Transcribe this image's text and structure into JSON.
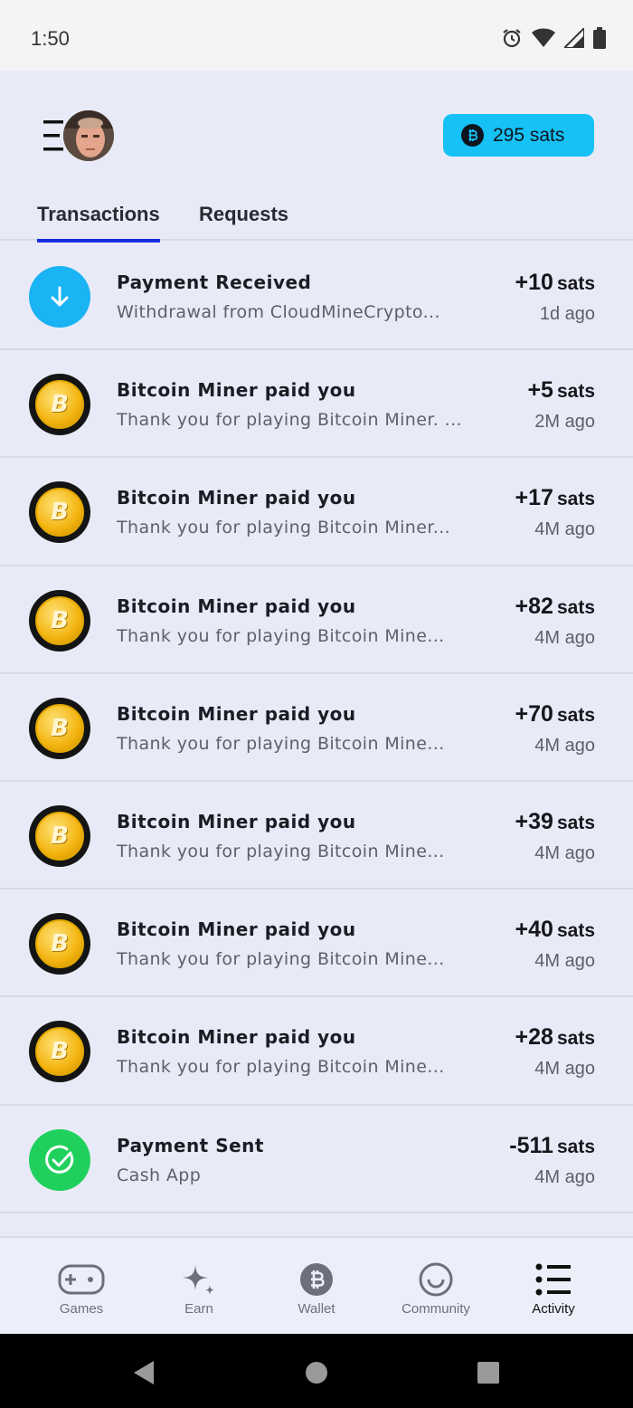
{
  "status_bar": {
    "time": "1:50"
  },
  "header": {
    "balance": "295 sats"
  },
  "tabs": [
    {
      "label": "Transactions",
      "active": true
    },
    {
      "label": "Requests",
      "active": false
    }
  ],
  "transactions": [
    {
      "type": "received",
      "title": "Payment Received",
      "subtitle": "Withdrawal from CloudMineCrypto...",
      "amount": "+10",
      "unit": "sats",
      "time": "1d ago"
    },
    {
      "type": "coin",
      "title": "Bitcoin Miner paid you",
      "subtitle": "Thank you for playing Bitcoin Miner. ...",
      "amount": "+5",
      "unit": "sats",
      "time": "2M ago"
    },
    {
      "type": "coin",
      "title": "Bitcoin Miner paid you",
      "subtitle": "Thank you for playing Bitcoin Miner...",
      "amount": "+17",
      "unit": "sats",
      "time": "4M ago"
    },
    {
      "type": "coin",
      "title": "Bitcoin Miner paid you",
      "subtitle": "Thank you for playing Bitcoin Mine...",
      "amount": "+82",
      "unit": "sats",
      "time": "4M ago"
    },
    {
      "type": "coin",
      "title": "Bitcoin Miner paid you",
      "subtitle": "Thank you for playing Bitcoin Mine...",
      "amount": "+70",
      "unit": "sats",
      "time": "4M ago"
    },
    {
      "type": "coin",
      "title": "Bitcoin Miner paid you",
      "subtitle": "Thank you for playing Bitcoin Mine...",
      "amount": "+39",
      "unit": "sats",
      "time": "4M ago"
    },
    {
      "type": "coin",
      "title": "Bitcoin Miner paid you",
      "subtitle": "Thank you for playing Bitcoin Mine...",
      "amount": "+40",
      "unit": "sats",
      "time": "4M ago"
    },
    {
      "type": "coin",
      "title": "Bitcoin Miner paid you",
      "subtitle": "Thank you for playing Bitcoin Mine...",
      "amount": "+28",
      "unit": "sats",
      "time": "4M ago"
    },
    {
      "type": "sent",
      "title": "Payment Sent",
      "subtitle": "Cash App",
      "amount": "-511",
      "unit": "sats",
      "time": "4M ago"
    }
  ],
  "bottom_nav": [
    {
      "label": "Games",
      "icon": "gamepad-icon",
      "active": false
    },
    {
      "label": "Earn",
      "icon": "sparkle-icon",
      "active": false
    },
    {
      "label": "Wallet",
      "icon": "bitcoin-icon",
      "active": false
    },
    {
      "label": "Community",
      "icon": "smiley-icon",
      "active": false
    },
    {
      "label": "Activity",
      "icon": "list-icon",
      "active": true
    }
  ],
  "colors": {
    "accent": "#16c1f5",
    "tab_underline": "#1a2ce0",
    "received": "#1ab3f3",
    "sent": "#1fd15c",
    "background": "#e8ebf7"
  }
}
